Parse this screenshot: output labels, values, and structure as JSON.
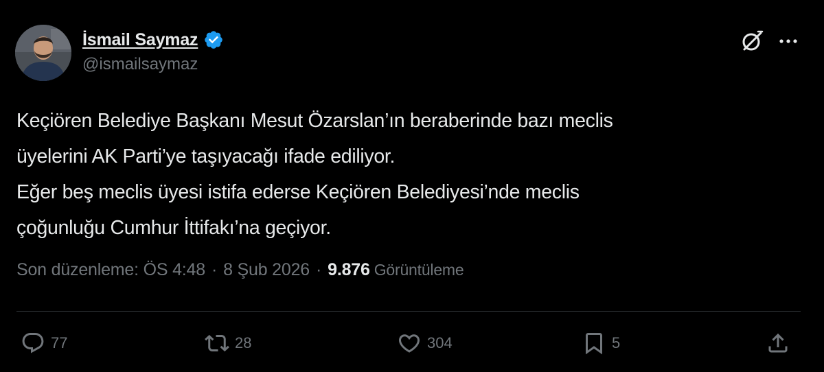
{
  "author": {
    "display_name": "İsmail Saymaz",
    "handle": "@ismailsaymaz",
    "verified": true
  },
  "tweet": {
    "lines": [
      "Keçiören Belediye Başkanı Mesut Özarslan’ın beraberinde bazı meclis",
      "üyelerini AK Parti’ye taşıyacağı ifade ediliyor.",
      "Eğer beş meclis üyesi istifa ederse Keçiören Belediyesi’nde meclis",
      "çoğunluğu Cumhur İttifakı’na geçiyor."
    ]
  },
  "meta": {
    "edited_label": "Son düzenleme: ÖS 4:48",
    "separator": "·",
    "date": "8 Şub 2026",
    "views_count": "9.876",
    "views_label": "Görüntüleme"
  },
  "actions": {
    "replies": "77",
    "retweets": "28",
    "likes": "304",
    "bookmarks": "5"
  },
  "icons": {
    "verified": "verified-badge-icon",
    "grok": "grok-icon",
    "more": "more-icon",
    "reply": "reply-icon",
    "retweet": "retweet-icon",
    "like": "heart-icon",
    "bookmark": "bookmark-icon",
    "share": "share-icon"
  },
  "colors": {
    "background": "#000000",
    "text": "#e7e9ea",
    "secondary": "#71767b",
    "verified": "#1d9bf0",
    "divider": "#2f3336"
  }
}
